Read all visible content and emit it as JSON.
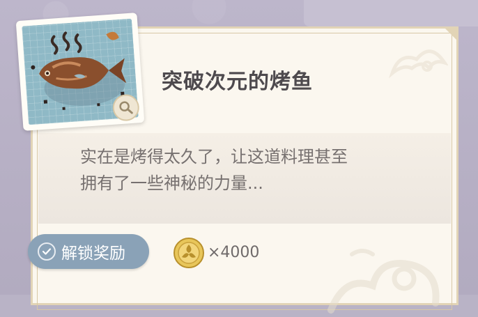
{
  "dish": {
    "title": "突破次元的烤鱼",
    "description_line1": "实在是烤得太久了，让这道料理甚至",
    "description_line2": "拥有了一些神秘的力量..."
  },
  "reward": {
    "label": "解锁奖励",
    "amount": "×4000",
    "currency_icon": "coin-icon"
  },
  "colors": {
    "card_bg": "#fbf7ef",
    "border": "#e2d4b6",
    "button": "#8aa2b7",
    "title_text": "#4e4a4e",
    "desc_text": "#76706f",
    "background": "#b9b3c6"
  }
}
